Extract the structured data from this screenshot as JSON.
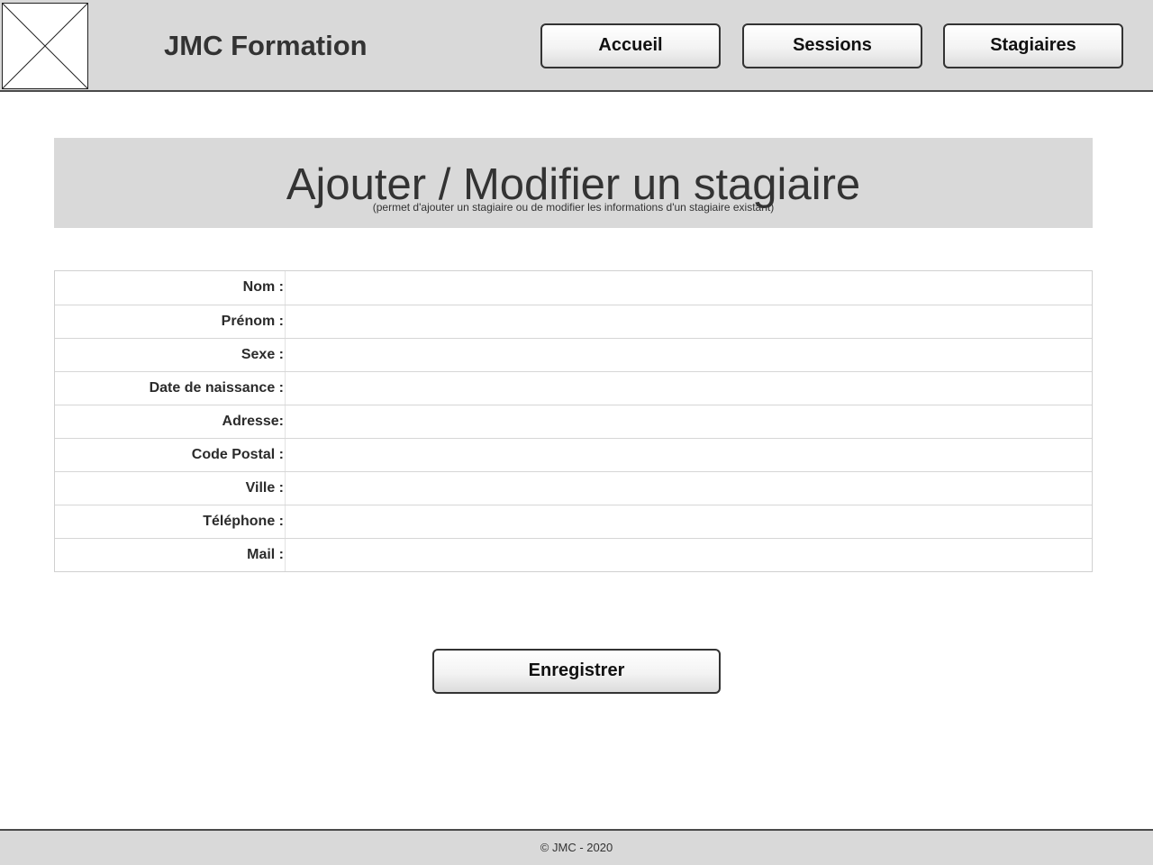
{
  "header": {
    "brand": "JMC Formation",
    "logo_icon": "image-placeholder-icon",
    "nav": {
      "accueil": "Accueil",
      "sessions": "Sessions",
      "stagiaires": "Stagiaires"
    }
  },
  "banner": {
    "title": "Ajouter / Modifier un stagiaire",
    "subtitle": "(permet d'ajouter un stagiaire ou de modifier les informations d'un stagiaire existant)"
  },
  "form": {
    "fields": [
      {
        "label": "Nom :",
        "value": ""
      },
      {
        "label": "Prénom :",
        "value": ""
      },
      {
        "label": "Sexe :",
        "value": ""
      },
      {
        "label": "Date de naissance :",
        "value": ""
      },
      {
        "label": "Adresse:",
        "value": ""
      },
      {
        "label": "Code Postal :",
        "value": ""
      },
      {
        "label": "Ville :",
        "value": ""
      },
      {
        "label": "Téléphone :",
        "value": ""
      },
      {
        "label": "Mail :",
        "value": ""
      }
    ],
    "save_label": "Enregistrer"
  },
  "footer": {
    "copyright": "© JMC - 2020"
  },
  "colors": {
    "header_bg": "#d9d9d9",
    "border_dark": "#4a4a4a",
    "text": "#333333"
  }
}
